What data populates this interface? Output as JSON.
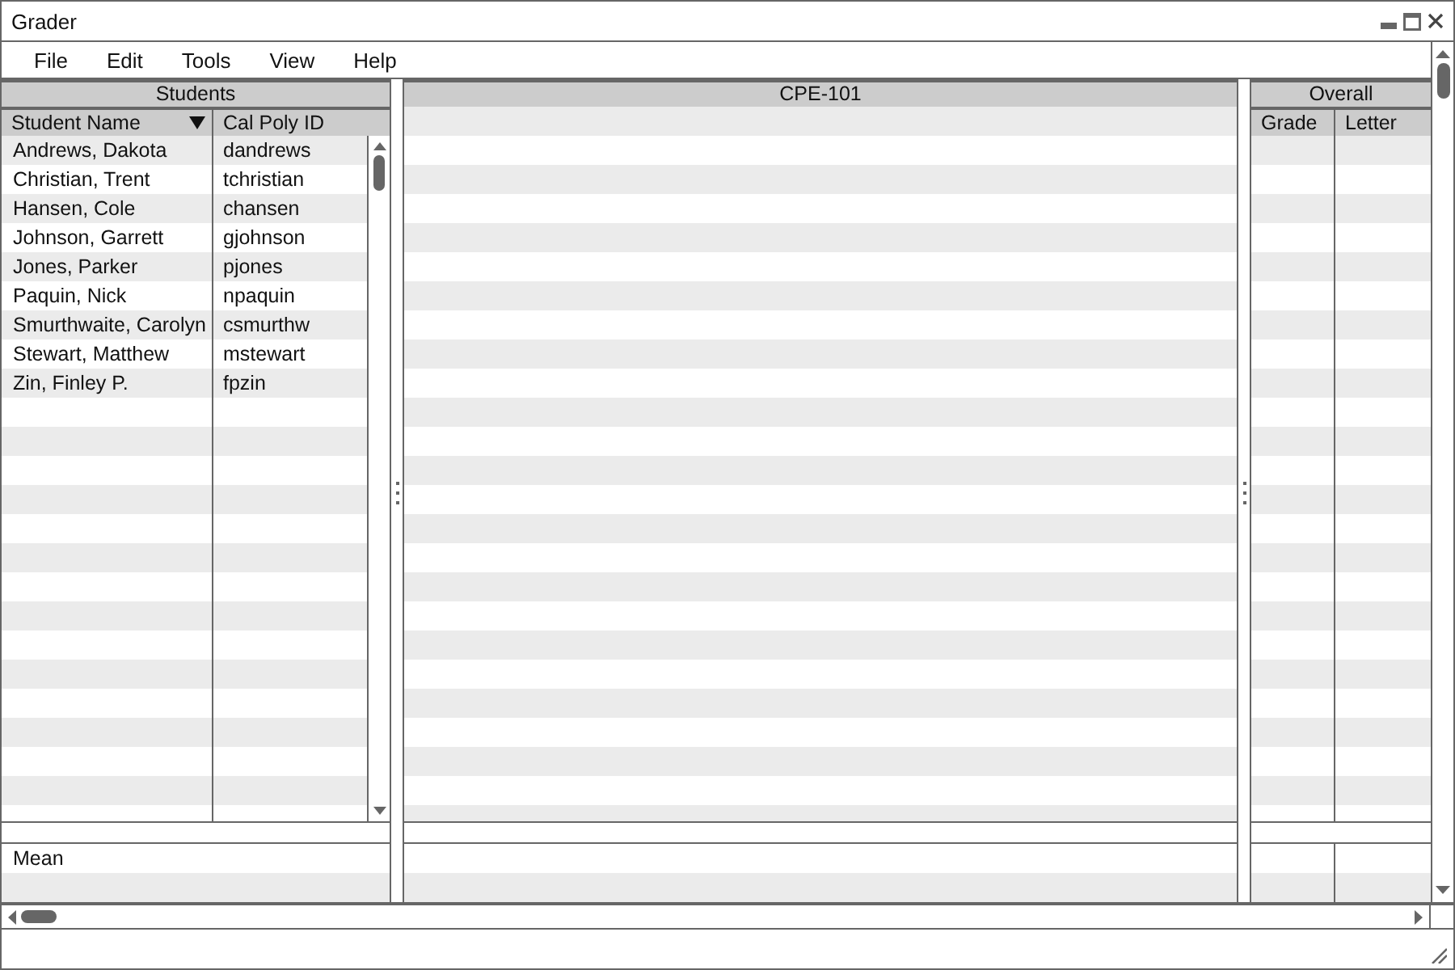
{
  "window": {
    "title": "Grader"
  },
  "menu": [
    "File",
    "Edit",
    "Tools",
    "View",
    "Help"
  ],
  "students": {
    "title": "Students",
    "columns": [
      {
        "label": "Student Name",
        "sorted": true
      },
      {
        "label": "Cal Poly ID",
        "sorted": false
      }
    ],
    "rows": [
      {
        "name": "Andrews, Dakota",
        "id": "dandrews"
      },
      {
        "name": "Christian, Trent",
        "id": "tchristian"
      },
      {
        "name": "Hansen, Cole",
        "id": "chansen"
      },
      {
        "name": "Johnson, Garrett",
        "id": "gjohnson"
      },
      {
        "name": "Jones, Parker",
        "id": "pjones"
      },
      {
        "name": "Paquin, Nick",
        "id": "npaquin"
      },
      {
        "name": "Smurthwaite, Carolyn",
        "id": "csmurthw"
      },
      {
        "name": "Stewart, Matthew",
        "id": "mstewart"
      },
      {
        "name": "Zin, Finley P.",
        "id": "fpzin"
      }
    ],
    "footer": "Mean"
  },
  "course": {
    "title": "CPE-101"
  },
  "overall": {
    "title": "Overall",
    "columns": [
      "Grade",
      "Letter"
    ]
  }
}
